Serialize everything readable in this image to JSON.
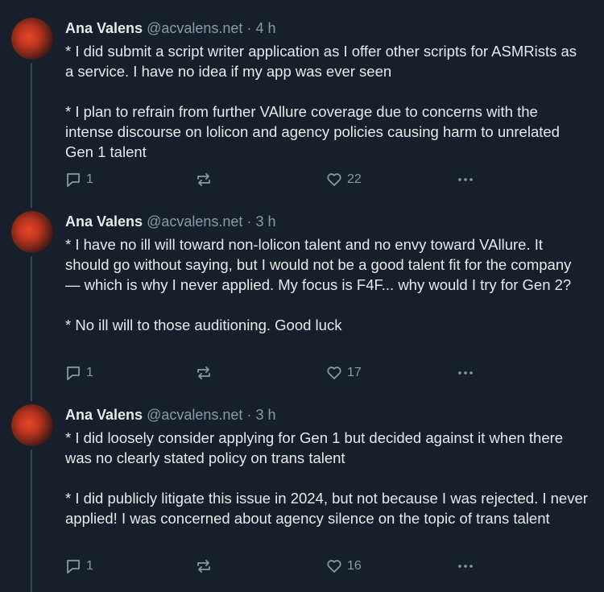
{
  "tweets": [
    {
      "author": "Ana Valens",
      "handle": "@acvalens.net",
      "dot": "·",
      "time": "4 h",
      "paragraphs": [
        "* I did submit a script writer application as I offer other scripts for ASMRists as a service. I have no idea if my app was ever seen",
        "* I plan to refrain from further VAllure coverage due to concerns with the intense discourse on lolicon and agency policies causing harm to unrelated Gen 1 talent"
      ],
      "replies": "1",
      "reposts": "",
      "likes": "22"
    },
    {
      "author": "Ana Valens",
      "handle": "@acvalens.net",
      "dot": "·",
      "time": "3 h",
      "paragraphs": [
        "* I have no ill will toward non-lolicon talent and no envy toward VAllure. It should go without saying, but I would not be a good talent fit for the company — which is why I never applied. My focus is F4F... why would I try for Gen 2?",
        "* No ill will to those auditioning. Good luck"
      ],
      "replies": "1",
      "reposts": "",
      "likes": "17"
    },
    {
      "author": "Ana Valens",
      "handle": "@acvalens.net",
      "dot": "·",
      "time": "3 h",
      "paragraphs": [
        "* I did loosely consider applying for Gen 1 but decided against it when there was no clearly stated policy on trans talent",
        "* I did publicly litigate this issue in 2024, but not because I was rejected. I never applied! I was concerned about agency silence on the topic of trans talent"
      ],
      "replies": "1",
      "reposts": "",
      "likes": "16"
    }
  ],
  "icons": {
    "reply": "reply-icon",
    "repost": "repost-icon",
    "like": "heart-icon",
    "more": "more-icon"
  },
  "colors": {
    "background": "#15202b",
    "text": "#e7e9ea",
    "secondary": "#8b98a5",
    "thread_line": "#38444d"
  }
}
